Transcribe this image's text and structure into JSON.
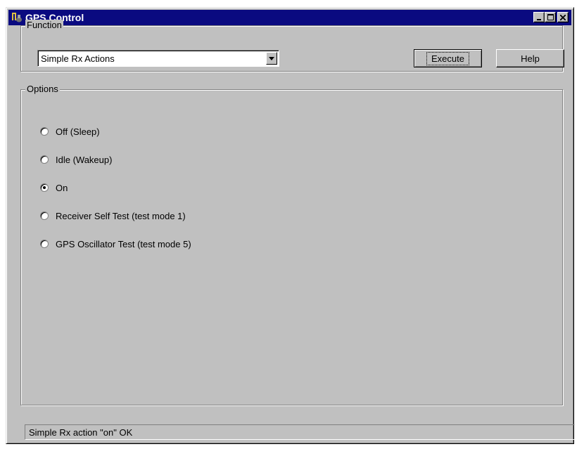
{
  "window": {
    "title": "GPS Control",
    "icon": "gps-app-icon",
    "controls": [
      "minimize-icon",
      "maximize-icon",
      "close-icon"
    ]
  },
  "function_group": {
    "label": "Function",
    "select_value": "Simple Rx Actions",
    "execute_label": "Execute",
    "help_label": "Help"
  },
  "options_group": {
    "label": "Options",
    "options": [
      {
        "label": "Off (Sleep)",
        "selected": false
      },
      {
        "label": "Idle (Wakeup)",
        "selected": false
      },
      {
        "label": "On",
        "selected": true
      },
      {
        "label": "Receiver Self Test (test mode 1)",
        "selected": false
      },
      {
        "label": "GPS Oscillator Test (test mode 5)",
        "selected": false
      }
    ]
  },
  "status_bar": {
    "text": "Simple Rx action \"on\" OK"
  }
}
